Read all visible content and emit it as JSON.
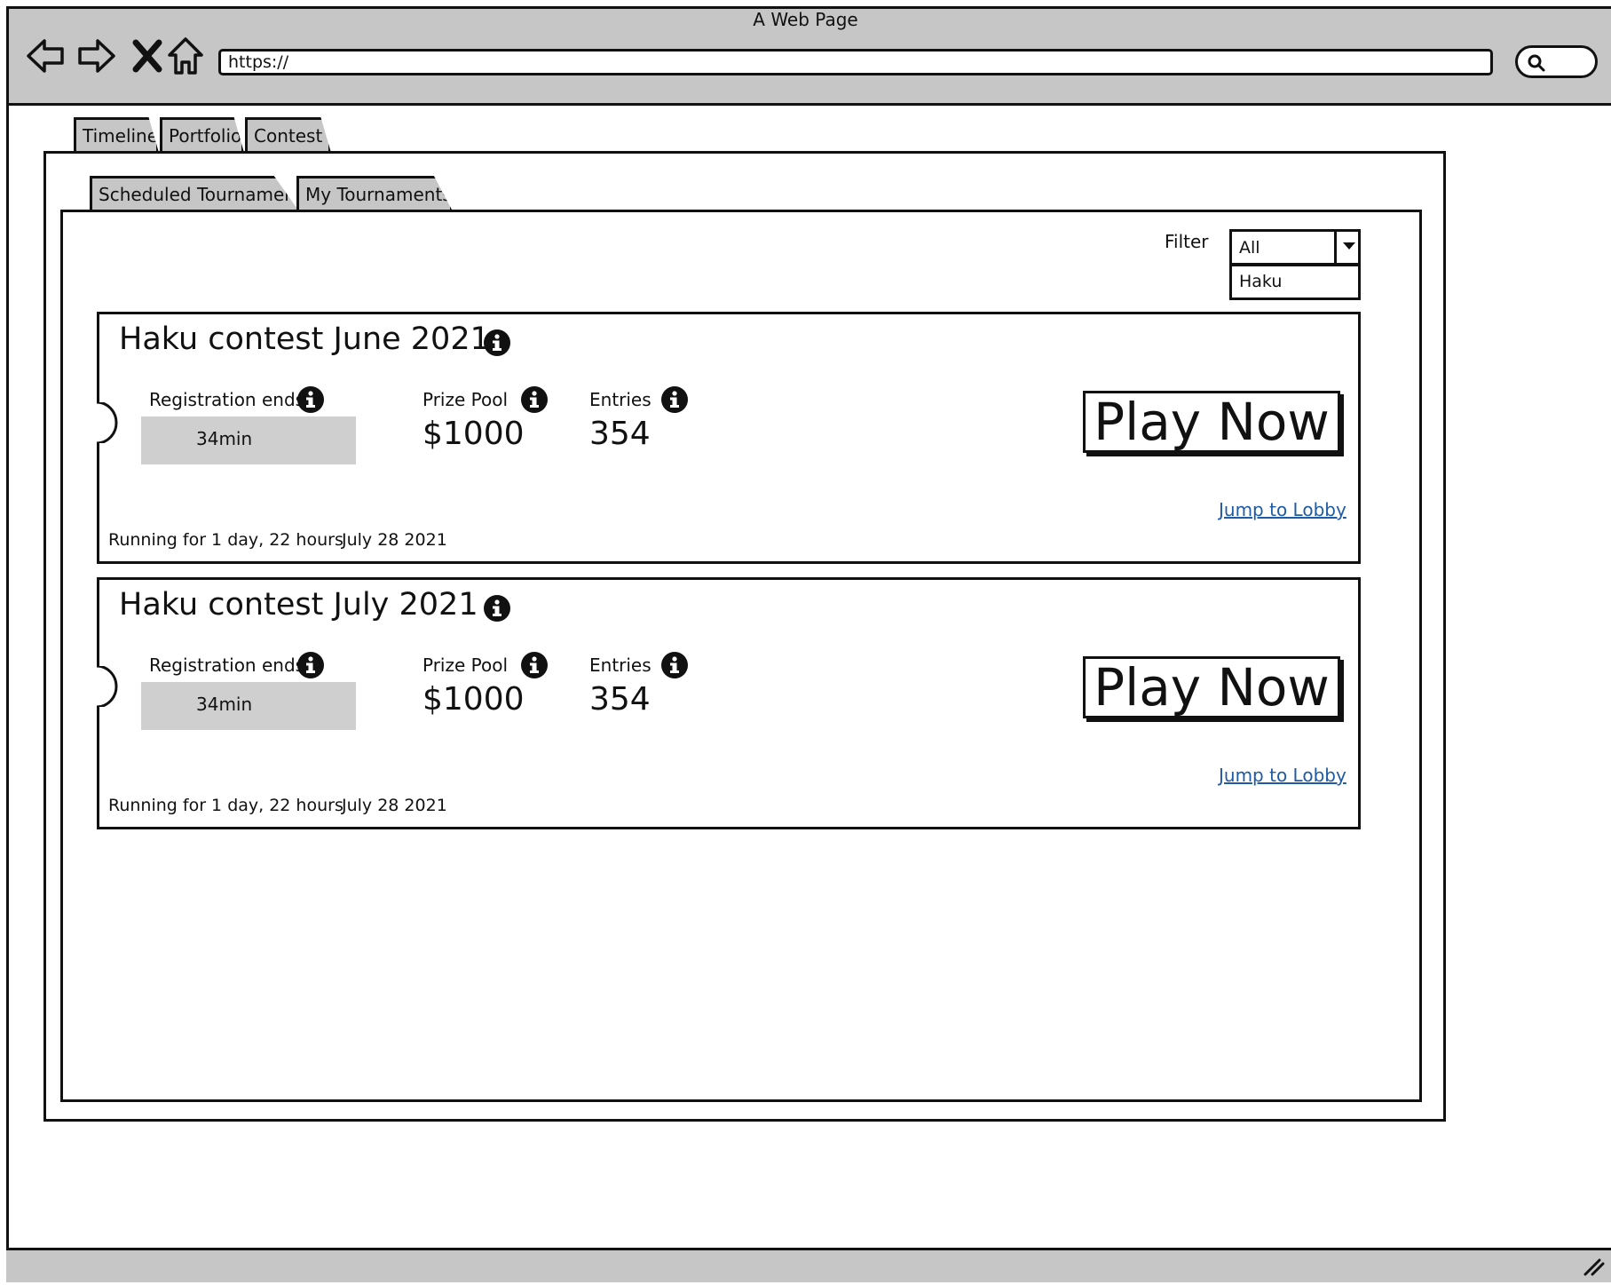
{
  "browser": {
    "title": "A Web Page",
    "url": "https://",
    "nav_icons": [
      "back-arrow-icon",
      "forward-arrow-icon",
      "stop-x-icon",
      "home-icon"
    ],
    "search_icon": "search-icon"
  },
  "main_tabs": [
    {
      "label": "Timeline"
    },
    {
      "label": "Portfolio"
    },
    {
      "label": "Contest"
    }
  ],
  "sub_tabs": [
    {
      "label": "Scheduled Tournament"
    },
    {
      "label": "My Tournaments"
    }
  ],
  "filter": {
    "label": "Filter",
    "selected": "All",
    "options": [
      "Haku"
    ]
  },
  "contests": [
    {
      "title": "Haku contest June 2021",
      "registration_label": "Registration ends",
      "registration_value": "34min",
      "prize_label": "Prize Pool",
      "prize_value": "$1000",
      "entries_label": "Entries",
      "entries_value": "354",
      "play_label": "Play Now",
      "lobby_label": "Jump to Lobby",
      "running": "Running for 1 day, 22 hours",
      "date": "July 28 2021"
    },
    {
      "title": "Haku contest July 2021",
      "registration_label": "Registration ends",
      "registration_value": "34min",
      "prize_label": "Prize Pool",
      "prize_value": "$1000",
      "entries_label": "Entries",
      "entries_value": "354",
      "play_label": "Play Now",
      "lobby_label": "Jump to Lobby",
      "running": "Running for 1 day, 22 hours",
      "date": "July 28 2021"
    }
  ],
  "colors": {
    "chrome_gray": "#c6c6c6",
    "countdown_gray": "#cfcfcf",
    "link_blue": "#1f5aa6",
    "stroke": "#111111"
  }
}
